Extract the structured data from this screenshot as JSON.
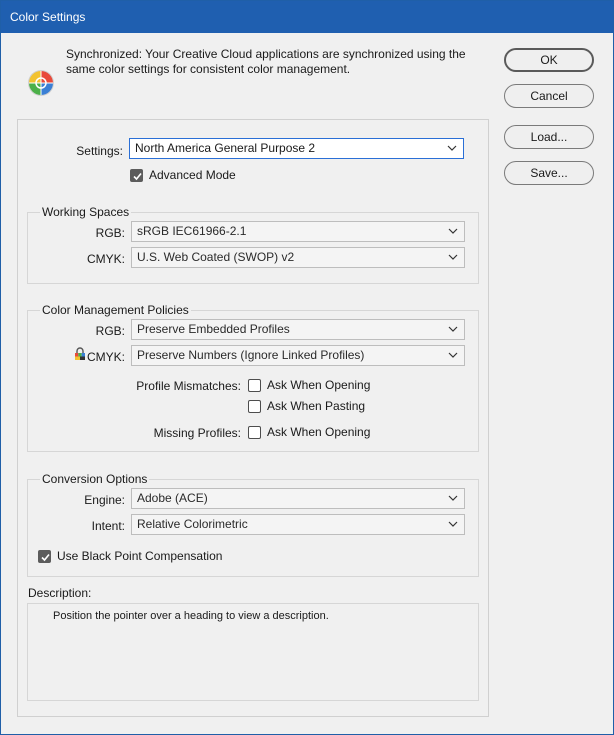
{
  "window": {
    "title": "Color Settings"
  },
  "sync": {
    "message": "Synchronized: Your Creative Cloud applications are synchronized using the same color settings for consistent color management.",
    "icon": "color-sync-icon"
  },
  "buttons": {
    "ok": "OK",
    "cancel": "Cancel",
    "load": "Load...",
    "save": "Save..."
  },
  "settings": {
    "label": "Settings:",
    "value": "North America General Purpose 2",
    "advanced_mode_label": "Advanced Mode",
    "advanced_mode_checked": true
  },
  "working_spaces": {
    "title": "Working Spaces",
    "rgb_label": "RGB:",
    "rgb_value": "sRGB IEC61966-2.1",
    "cmyk_label": "CMYK:",
    "cmyk_value": "U.S. Web Coated (SWOP) v2"
  },
  "policies": {
    "title": "Color Management Policies",
    "rgb_label": "RGB:",
    "rgb_value": "Preserve Embedded Profiles",
    "cmyk_label": "CMYK:",
    "cmyk_value": "Preserve Numbers (Ignore Linked Profiles)",
    "mismatch_label": "Profile Mismatches:",
    "ask_opening": "Ask When Opening",
    "ask_pasting": "Ask When Pasting",
    "missing_label": "Missing Profiles:",
    "missing_ask_opening": "Ask When Opening"
  },
  "conversion": {
    "title": "Conversion Options",
    "engine_label": "Engine:",
    "engine_value": "Adobe (ACE)",
    "intent_label": "Intent:",
    "intent_value": "Relative Colorimetric",
    "bpc_label": "Use Black Point Compensation",
    "bpc_checked": true
  },
  "description": {
    "label": "Description:",
    "text": "Position the pointer over a heading to view a description."
  },
  "colors": {
    "titlebar": "#1f5fb0",
    "focus_border": "#2a6fd6",
    "window_bg": "#f0f0f0"
  }
}
